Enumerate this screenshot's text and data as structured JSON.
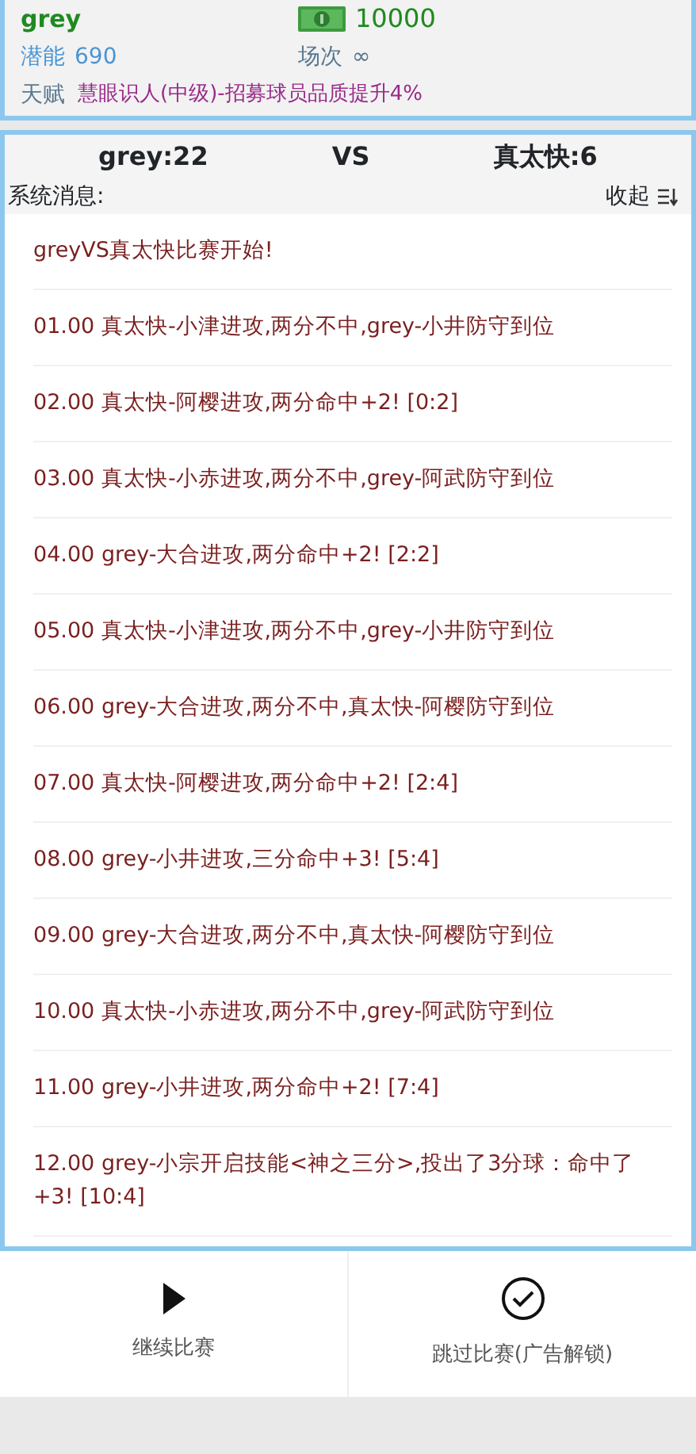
{
  "player": {
    "name": "grey",
    "money": "10000",
    "potential_label": "潜能",
    "potential": "690",
    "matches_label": "场次",
    "matches": "∞",
    "talent_label": "天赋",
    "talent": "慧眼识人(中级)-招募球员品质提升4%"
  },
  "scoreboard": {
    "home": "grey:22",
    "vs": "VS",
    "away": "真太快:6"
  },
  "messages_header": {
    "title": "系统消息:",
    "toggle": "收起"
  },
  "messages": [
    "greyVS真太快比赛开始!",
    "01.00 真太快-小津进攻,两分不中,grey-小井防守到位",
    "02.00 真太快-阿樱进攻,两分命中+2! [0:2]",
    "03.00 真太快-小赤进攻,两分不中,grey-阿武防守到位",
    "04.00 grey-大合进攻,两分命中+2! [2:2]",
    "05.00 真太快-小津进攻,两分不中,grey-小井防守到位",
    "06.00 grey-大合进攻,两分不中,真太快-阿樱防守到位",
    "07.00 真太快-阿樱进攻,两分命中+2! [2:4]",
    "08.00 grey-小井进攻,三分命中+3! [5:4]",
    "09.00 grey-大合进攻,两分不中,真太快-阿樱防守到位",
    "10.00 真太快-小赤进攻,两分不中,grey-阿武防守到位",
    "11.00 grey-小井进攻,两分命中+2! [7:4]",
    "12.00 grey-小宗开启技能<神之三分>,投出了3分球：命中了+3! [10:4]"
  ],
  "actions": [
    {
      "kind": "play",
      "label": "继续比赛"
    },
    {
      "kind": "check",
      "label": "跳过比赛(广告解锁)"
    }
  ]
}
